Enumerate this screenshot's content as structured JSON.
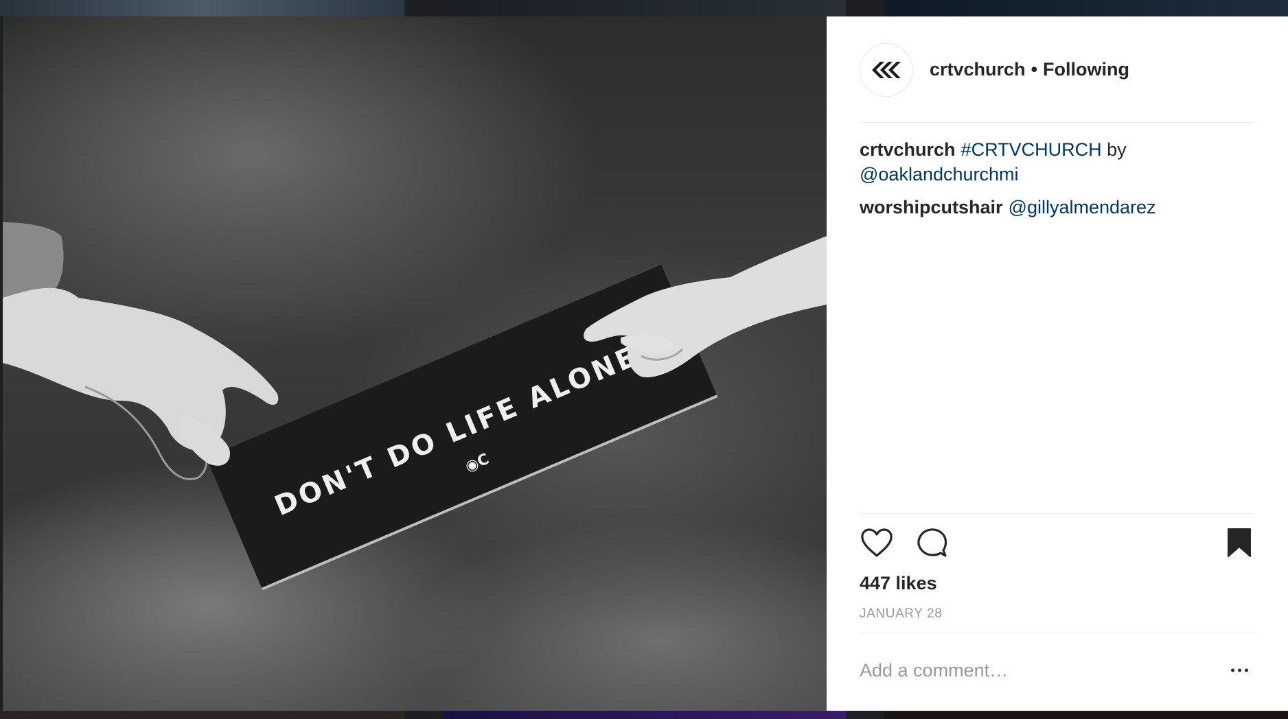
{
  "post": {
    "username": "crtvchurch",
    "separator": "•",
    "follow_status": "Following",
    "photo_text": "DON'T DO LIFE ALONE.",
    "comments": [
      {
        "user": "crtvchurch",
        "hashtag": "#CRTVCHURCH",
        "mid_text": "by",
        "mention": "@oaklandchurchmi"
      },
      {
        "user": "worshipcutshair",
        "mention": "@gillyalmendarez"
      }
    ],
    "likes": "447 likes",
    "date": "JANUARY 28",
    "comment_placeholder": "Add a comment…"
  },
  "icons": {
    "avatar": "crtvchurch-logo-icon",
    "like": "heart-icon",
    "comment": "comment-bubble-icon",
    "save": "bookmark-icon",
    "more": "more-options-icon"
  },
  "colors": {
    "text": "#262626",
    "link": "#003569",
    "muted": "#999999",
    "divider": "#efefef"
  }
}
